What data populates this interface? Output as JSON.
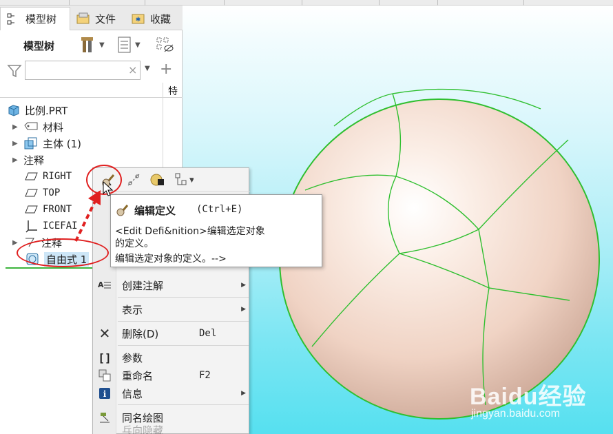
{
  "tabs": [
    {
      "label": "模型树",
      "icon": "tree-icon"
    },
    {
      "label": "文件",
      "icon": "folder-icon"
    },
    {
      "label": "收藏",
      "icon": "favorites-icon"
    }
  ],
  "model_tree": {
    "title": "模型树",
    "filter": {
      "value": "",
      "clear": "×"
    },
    "column_header": "特",
    "items": [
      {
        "label": "比例.PRT",
        "icon": "part-icon",
        "expandable": false
      },
      {
        "label": "材料",
        "icon": "material-icon",
        "expandable": true
      },
      {
        "label": "主体 (1)",
        "icon": "body-icon",
        "expandable": true
      },
      {
        "label": "注释",
        "icon": "",
        "expandable": true
      },
      {
        "label": "RIGHT",
        "icon": "datum-plane-icon",
        "expandable": false
      },
      {
        "label": "TOP",
        "icon": "datum-plane-icon",
        "expandable": false
      },
      {
        "label": "FRONT",
        "icon": "datum-plane-icon",
        "expandable": false
      },
      {
        "label": "ICEFAI  ",
        "icon": "csys-icon",
        "expandable": false
      },
      {
        "label": "注释",
        "icon": "annotation-icon",
        "expandable": true
      },
      {
        "label": "自由式 1",
        "icon": "freestyle-icon",
        "expandable": false,
        "selected": true
      }
    ]
  },
  "context_menu": {
    "items": [
      {
        "label": "创建注解",
        "icon": "annotation-create-icon",
        "shortcut": "",
        "submenu": true
      },
      {
        "label": "表示",
        "icon": "",
        "shortcut": "",
        "submenu": true
      },
      {
        "label": "删除(D)",
        "icon": "delete-icon",
        "shortcut": "Del",
        "submenu": false
      },
      {
        "label": "参数",
        "icon": "parameters-icon",
        "shortcut": "",
        "submenu": false
      },
      {
        "label": "重命名",
        "icon": "rename-icon",
        "shortcut": "F2",
        "submenu": false
      },
      {
        "label": "信息",
        "icon": "info-icon",
        "shortcut": "",
        "submenu": true
      },
      {
        "label": "同名绘图",
        "icon": "drawing-icon",
        "shortcut": "",
        "submenu": false
      },
      {
        "label": "乓向隐藏",
        "icon": "hide-icon",
        "shortcut": "",
        "submenu": false
      }
    ]
  },
  "tooltip": {
    "title": "编辑定义",
    "shortcut": "(Ctrl+E)",
    "line1": "<Edit Defi&nition>编辑选定对象",
    "line2": "的定义。",
    "line3": "编辑选定对象的定义。-->"
  },
  "watermark": {
    "logo": "Baidu经验",
    "url": "jingyan.baidu.com"
  },
  "colors": {
    "selection": "#cde6f7",
    "annotation_red": "#e02020",
    "edge_green": "#2fbf2f",
    "sphere": "#f1d6c9",
    "background_cyan": "#56e0f0"
  }
}
